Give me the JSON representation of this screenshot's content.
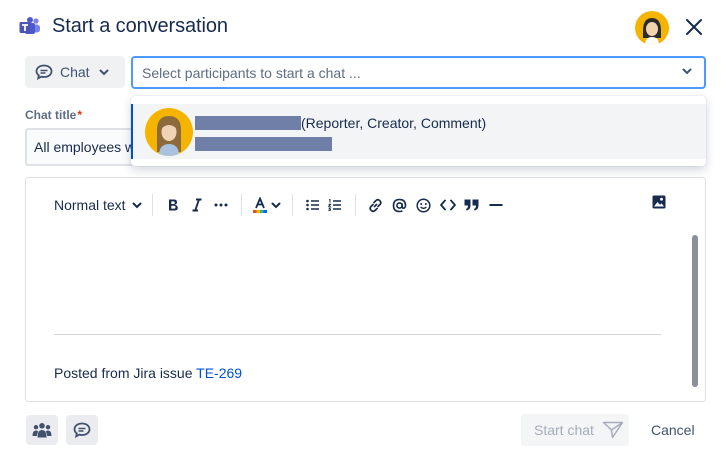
{
  "dialog": {
    "title": "Start a conversation"
  },
  "mode_select": {
    "selected": "Chat",
    "icon": "chat-bubble-icon"
  },
  "participants": {
    "placeholder": "Select participants to start a chat ...",
    "value": ""
  },
  "chat_title": {
    "label": "Chat title",
    "required_marker": "*",
    "value": "All employees w"
  },
  "suggestion": {
    "roles": "(Reporter, Creator, Comment)",
    "name_redacted": true,
    "email_redacted": true
  },
  "toolbar": {
    "text_style": "Normal text",
    "buttons": [
      "bold-icon",
      "italic-icon",
      "more-formatting-icon",
      "text-color-icon",
      "bullet-list-icon",
      "numbered-list-icon",
      "link-icon",
      "mention-icon",
      "emoji-icon",
      "code-icon",
      "quote-icon",
      "divider-icon",
      "image-icon"
    ]
  },
  "editor": {
    "posted_prefix": "Posted from Jira issue",
    "issue_key": "TE-269"
  },
  "footer": {
    "start_label": "Start chat",
    "cancel_label": "Cancel"
  },
  "colors": {
    "accent": "#0052cc",
    "focus": "#4c9aff",
    "avatar": "#f5b400",
    "teams": "#5059c9"
  }
}
